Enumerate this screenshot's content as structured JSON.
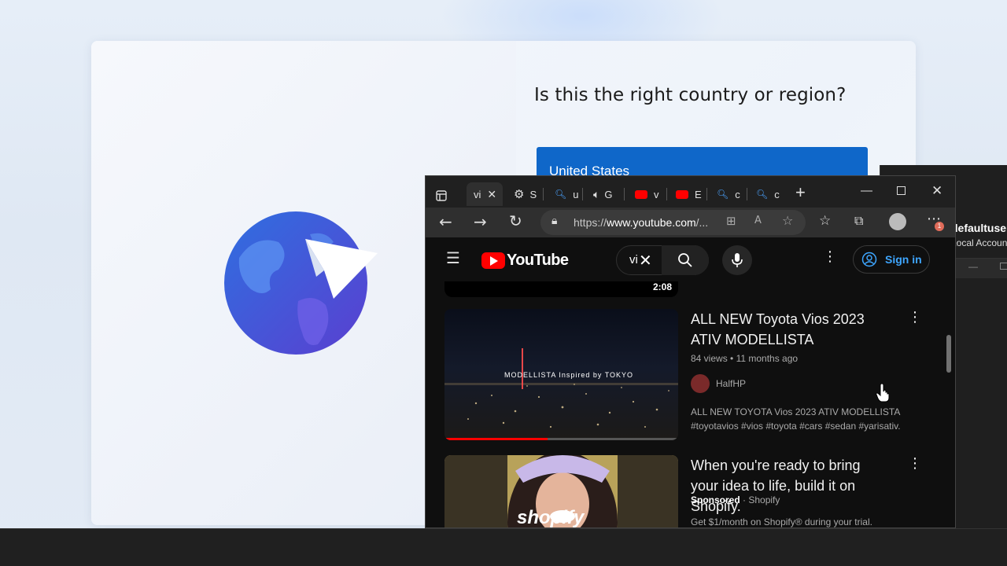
{
  "oobe": {
    "title": "Is this the right country or region?",
    "selected_country": "United States"
  },
  "background_window": {
    "user_name": "defaultuser",
    "account_type": "Local Account"
  },
  "browser": {
    "tabs": [
      {
        "label": "vi",
        "icon": "youtube-tab-icon",
        "active": true
      },
      {
        "label": "S",
        "icon": "gear-icon"
      },
      {
        "label": "u",
        "icon": "search-icon"
      },
      {
        "label": "G",
        "icon": "speaker-icon"
      },
      {
        "label": "v",
        "icon": "youtube-icon"
      },
      {
        "label": "E",
        "icon": "youtube-icon"
      },
      {
        "label": "c",
        "icon": "search-icon"
      },
      {
        "label": "c",
        "icon": "search-icon"
      }
    ],
    "url_prefix": "https://",
    "url_host": "www.youtube.com",
    "url_suffix": "/...",
    "notification_count": "1"
  },
  "youtube": {
    "logo_text": "YouTube",
    "search_query": "vi",
    "signin_label": "Sign in",
    "prev_duration": "2:08",
    "videos": [
      {
        "title": "ALL NEW Toyota Vios 2023 ATIV MODELLISTA",
        "views": "84 views",
        "age": "11 months ago",
        "channel": "HalfHP",
        "thumb_caption": "MODELLISTA Inspired by TOKYO",
        "description_1": "ALL NEW TOYOTA Vios 2023 ATIV MODELLISTA",
        "description_2": "#toyotavios #vios #toyota #cars #sedan #yarisativ.",
        "progress": 0.44
      },
      {
        "title": "When you're ready to bring your idea to life, build it on Shopify.",
        "sponsored": "Sponsored",
        "channel": "Shopify",
        "thumb_caption": "shopify",
        "description_1": "Get $1/month on Shopify® during your trial."
      }
    ]
  },
  "colors": {
    "oobe_accent": "#0f67c9",
    "youtube_red": "#ff0000",
    "signin_blue": "#3ea6ff"
  }
}
